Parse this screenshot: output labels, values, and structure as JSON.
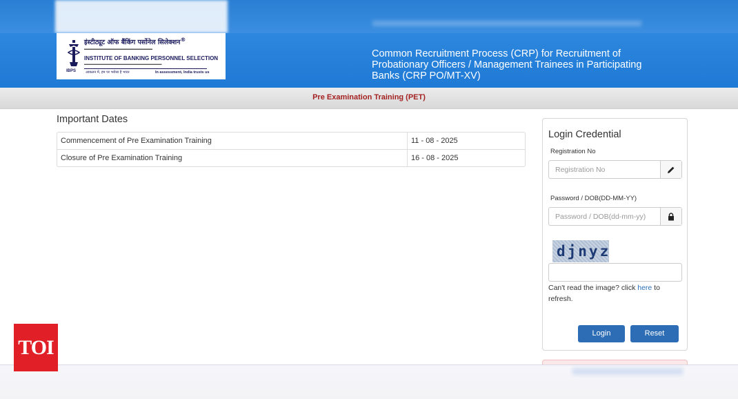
{
  "header": {
    "logo": {
      "hindi_name": "इंस्टीट्यूट ऑफ बैंकिंग पर्सोनेल सिलेक्शन",
      "registered_mark": "®",
      "english_name": "INSTITUTE OF BANKING PERSONNEL SELECTION",
      "abbr": "IBPS",
      "tagline_hindi": "आकलन में, हम पर भरोसा है भारत",
      "tagline_english": "In assessment, India trusts us"
    },
    "title": "Common Recruitment Process (CRP) for Recruitment of Probationary Officers / Management Trainees in Participating Banks (CRP PO/MT-XV)"
  },
  "subbar": {
    "title": "Pre Examination Training (PET)"
  },
  "dates": {
    "heading": "Important Dates",
    "rows": [
      {
        "label": "Commencement of Pre Examination Training",
        "value": "11 - 08 - 2025"
      },
      {
        "label": "Closure of Pre Examination Training",
        "value": "16 - 08 - 2025"
      }
    ]
  },
  "login": {
    "title": "Login Credential",
    "registration_label": "Registration No",
    "registration_placeholder": "Registration No",
    "registration_value": "",
    "password_label": "Password / DOB(DD-MM-YY)",
    "password_placeholder": "Password / DOB(dd-mm-yy)",
    "password_value": "",
    "captcha_text": "djnyz",
    "captcha_value": "",
    "help_prefix": "Can't read the image? click ",
    "help_link": "here",
    "help_suffix": " to refresh.",
    "login_button": "Login",
    "reset_button": "Reset",
    "icons": {
      "registration": "pencil-icon",
      "password": "lock-icon"
    }
  },
  "watermark": {
    "text": "TOI",
    "color": "#e01f26"
  },
  "colors": {
    "header_blue": "#2d87de",
    "button_blue": "#2d6db5",
    "subtitle_red": "#a42121",
    "link_blue": "#2a6fb8"
  }
}
